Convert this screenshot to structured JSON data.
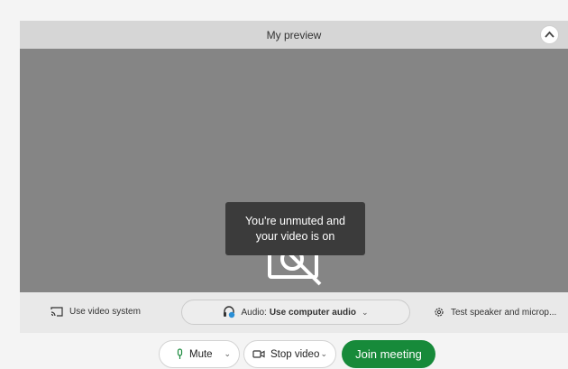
{
  "preview": {
    "title": "My preview",
    "collapse_icon": "chevron-up-icon",
    "toast_line1": "You're unmuted and",
    "toast_line2": "your video is on",
    "camera_icon": "camera-off-icon"
  },
  "options": {
    "video_system_label": "Use video system",
    "video_system_icon": "cast-icon",
    "audio_prefix": "Audio:",
    "audio_value": "Use computer audio",
    "audio_icon": "headset-icon",
    "test_speaker_label": "Test speaker and microp...",
    "test_speaker_icon": "gear-icon"
  },
  "controls": {
    "mute_label": "Mute",
    "mute_icon": "microphone-icon",
    "stop_video_label": "Stop video",
    "stop_video_icon": "video-camera-icon",
    "join_label": "Join meeting"
  },
  "colors": {
    "join_button": "#178a3a",
    "video_background": "#858585",
    "toast_background": "#3b3b3b"
  }
}
